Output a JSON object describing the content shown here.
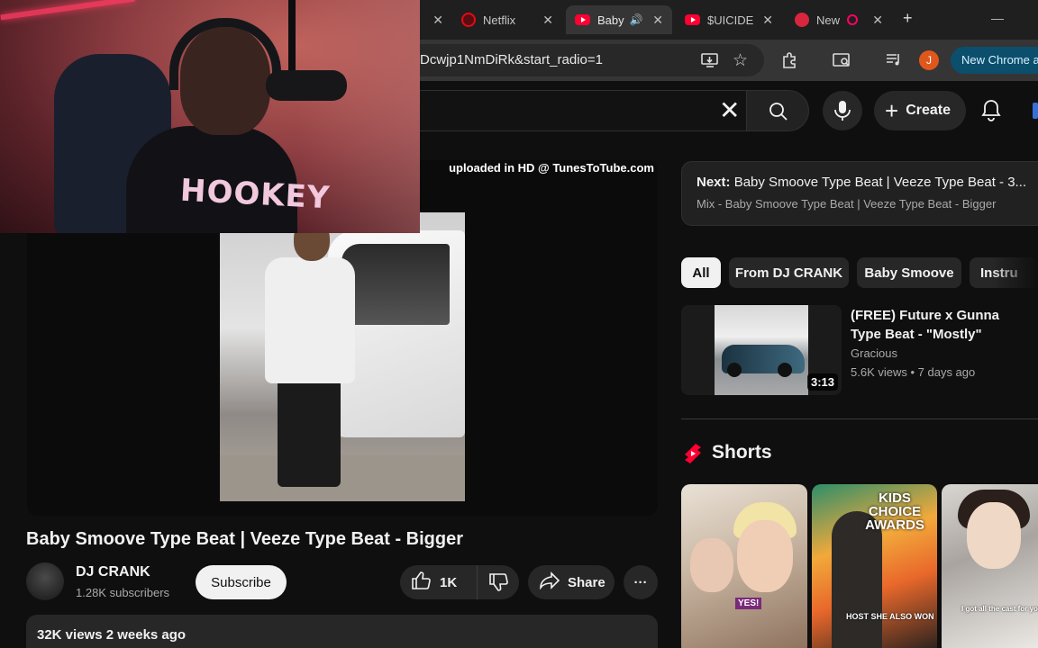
{
  "browser": {
    "tabs": [
      {
        "label": "",
        "close": "✕"
      },
      {
        "label": "Netflix",
        "close": "✕"
      },
      {
        "label": "Baby",
        "close": "✕",
        "audio": "🔊"
      },
      {
        "label": "$UICIDE",
        "close": "✕"
      },
      {
        "label": "New",
        "close": "✕"
      }
    ],
    "new_tab": "+",
    "minimize": "—",
    "url": "Dcwjp1NmDiRk&start_radio=1",
    "profile_initial": "J",
    "new_chrome_label": "New Chrome av"
  },
  "youtube": {
    "create_label": "Create",
    "search_clear": "✕"
  },
  "video": {
    "watermark": "uploaded in HD @ TunesToTube.com",
    "shirt_text": "HOOKEY",
    "title": "Baby Smoove Type Beat | Veeze Type Beat - Bigger",
    "channel": "DJ CRANK",
    "subscribers": "1.28K subscribers",
    "subscribe_label": "Subscribe",
    "likes": "1K",
    "share_label": "Share",
    "more": "···",
    "views_date": "32K views  2 weeks ago"
  },
  "sidebar": {
    "next_label": "Next:",
    "next_title": "Baby Smoove Type Beat | Veeze Type Beat - 3...",
    "mix_subtitle": "Mix - Baby Smoove Type Beat | Veeze Type Beat - Bigger",
    "chips": [
      "All",
      "From DJ CRANK",
      "Baby Smoove",
      "Instru"
    ],
    "recommendation": {
      "title": "(FREE) Future x Gunna Type Beat - \"Mostly\"",
      "channel": "Gracious",
      "meta": "5.6K views • 7 days ago",
      "duration": "3:13"
    },
    "shorts_title": "Shorts",
    "shorts": [
      {
        "tag": "YES!"
      },
      {
        "overlay": "KIDS CHOICE AWARDS",
        "caption": "HOST SHE ALSO WON"
      },
      {
        "caption": "I got all the cast for you"
      }
    ]
  },
  "colors": {
    "background": "#0f0f0f",
    "youtube_red": "#ff0033",
    "chip_active": "#f1f1f1",
    "chip": "#272727"
  }
}
